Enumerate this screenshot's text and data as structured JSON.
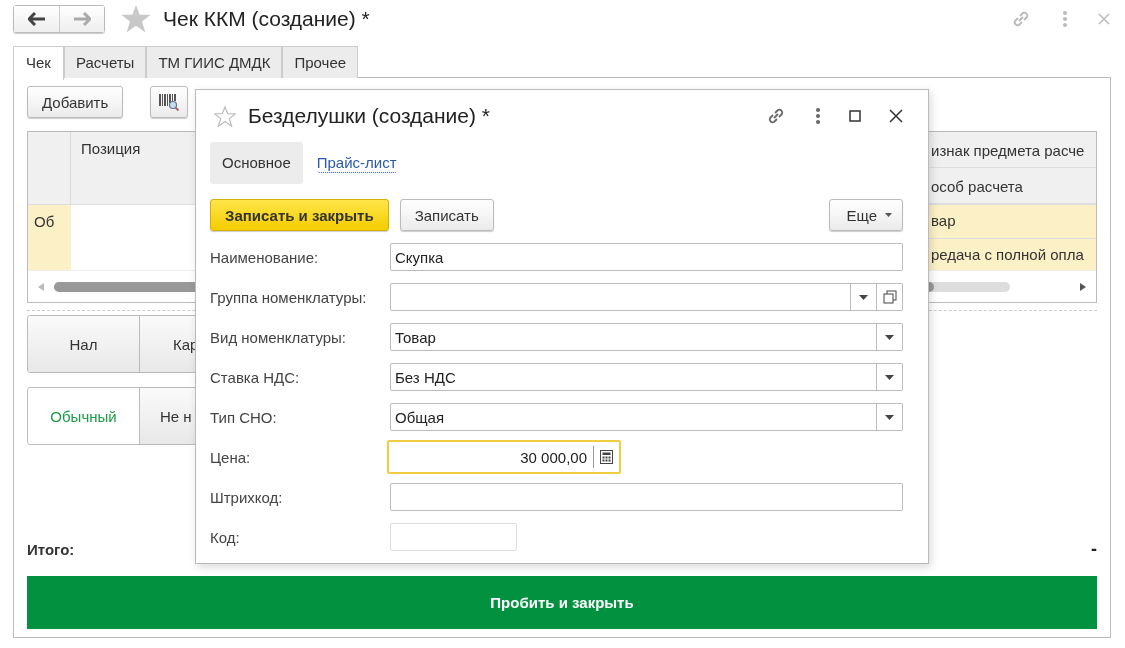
{
  "window": {
    "title": "Чек ККМ (создание) *"
  },
  "tabs": [
    {
      "label": "Чек",
      "selected": true
    },
    {
      "label": "Расчеты",
      "selected": false
    },
    {
      "label": "ТМ ГИИС ДМДК",
      "selected": false
    },
    {
      "label": "Прочее",
      "selected": false
    }
  ],
  "add_button": "Добавить",
  "table": {
    "column_2": "Позиция",
    "column_3": [
      "изнак предмета расче",
      "особ расчета"
    ],
    "rows": [
      {
        "column_1": "Об",
        "column_3": [
          "вар",
          "редача с полной опла"
        ],
        "selected": true
      }
    ]
  },
  "payment_buttons": [
    {
      "label": "Нал",
      "selected": false
    },
    {
      "label": "Кар",
      "selected": false
    }
  ],
  "mode_buttons": [
    {
      "label": "Обычный",
      "selected": true
    },
    {
      "label": "Не н",
      "selected": false
    }
  ],
  "total": {
    "label": "Итого:",
    "value": "-"
  },
  "submit_button": "Пробить и закрыть",
  "dialog": {
    "title": "Безделушки (создание) *",
    "tabs": [
      {
        "label": "Основное",
        "selected": true
      },
      {
        "label": "Прайс-лист",
        "selected": false
      }
    ],
    "buttons": [
      {
        "label": "Записать и закрыть",
        "kind": "primary"
      },
      {
        "label": "Записать",
        "kind": "default"
      }
    ],
    "more_button": "Еще",
    "fields": [
      {
        "label": "Наименование:",
        "value": "Скупка",
        "kind": "text",
        "focused": false
      },
      {
        "label": "Группа номенклатуры:",
        "kind": "select_open",
        "focused": false
      },
      {
        "label": "Вид номенклатуры:",
        "value": "Товар",
        "kind": "select",
        "focused": false
      },
      {
        "label": "Ставка НДС:",
        "value": "Без НДС",
        "kind": "select",
        "focused": false
      },
      {
        "label": "Тип СНО:",
        "value": "Общая",
        "kind": "select",
        "focused": false
      },
      {
        "label": "Цена:",
        "value": "30 000,00",
        "kind": "number",
        "focused": true
      },
      {
        "label": "Штрихкод:",
        "kind": "text",
        "focused": false
      },
      {
        "label": "Код:",
        "kind": "short",
        "focused": false
      }
    ]
  }
}
